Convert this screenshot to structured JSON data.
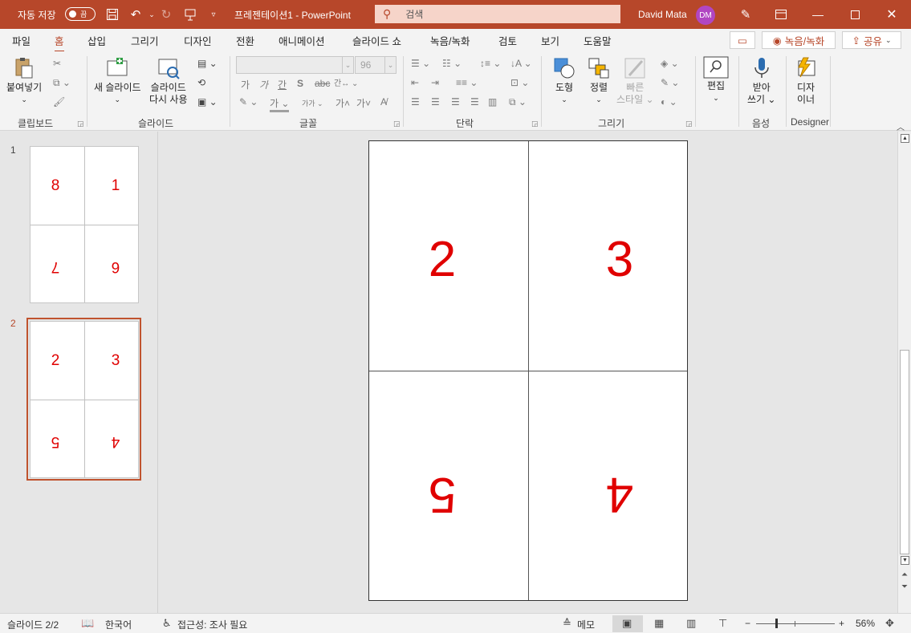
{
  "titlebar": {
    "autosave_label": "자동 저장",
    "autosave_state": "끔",
    "doc_title": "프레젠테이션1  -  PowerPoint",
    "search_placeholder": "검색",
    "user_name": "David Mata",
    "user_initials": "DM",
    "accent_color": "#b7472a"
  },
  "tabs": [
    "파일",
    "홈",
    "삽입",
    "그리기",
    "디자인",
    "전환",
    "애니메이션",
    "슬라이드 쇼",
    "녹음/녹화",
    "검토",
    "보기",
    "도움말"
  ],
  "active_tab": "홈",
  "tab_buttons": {
    "record": "녹음/녹화",
    "share": "공유"
  },
  "ribbon": {
    "clipboard": {
      "paste": "붙여넣기",
      "label": "클립보드"
    },
    "slides": {
      "new_slide": "새 슬라이드",
      "reuse_line1": "슬라이드",
      "reuse_line2": "다시 사용",
      "label": "슬라이드"
    },
    "font": {
      "font_size": "96",
      "label": "글꼴"
    },
    "paragraph": {
      "label": "단락"
    },
    "drawing": {
      "shapes": "도형",
      "arrange": "정렬",
      "quick_styles_line1": "빠른",
      "quick_styles_line2": "스타일",
      "label": "그리기"
    },
    "editing": {
      "edit": "편집"
    },
    "voice": {
      "dictate_line1": "받아",
      "dictate_line2": "쓰기",
      "label": "음성"
    },
    "designer": {
      "line1": "디자",
      "line2": "이너",
      "label": "Designer"
    }
  },
  "slides": [
    {
      "number": "1",
      "quadrants": [
        "8",
        "1",
        "7",
        "6"
      ],
      "flipped_bottom": true
    },
    {
      "number": "2",
      "quadrants": [
        "2",
        "3",
        "5",
        "4"
      ],
      "flipped_bottom": true,
      "selected": true
    }
  ],
  "current_slide": {
    "quadrants": [
      "2",
      "3",
      "5",
      "4"
    ]
  },
  "status": {
    "slide_counter": "슬라이드 2/2",
    "language": "한국어",
    "accessibility": "접근성: 조사 필요",
    "notes": "메모",
    "zoom": "56%"
  }
}
